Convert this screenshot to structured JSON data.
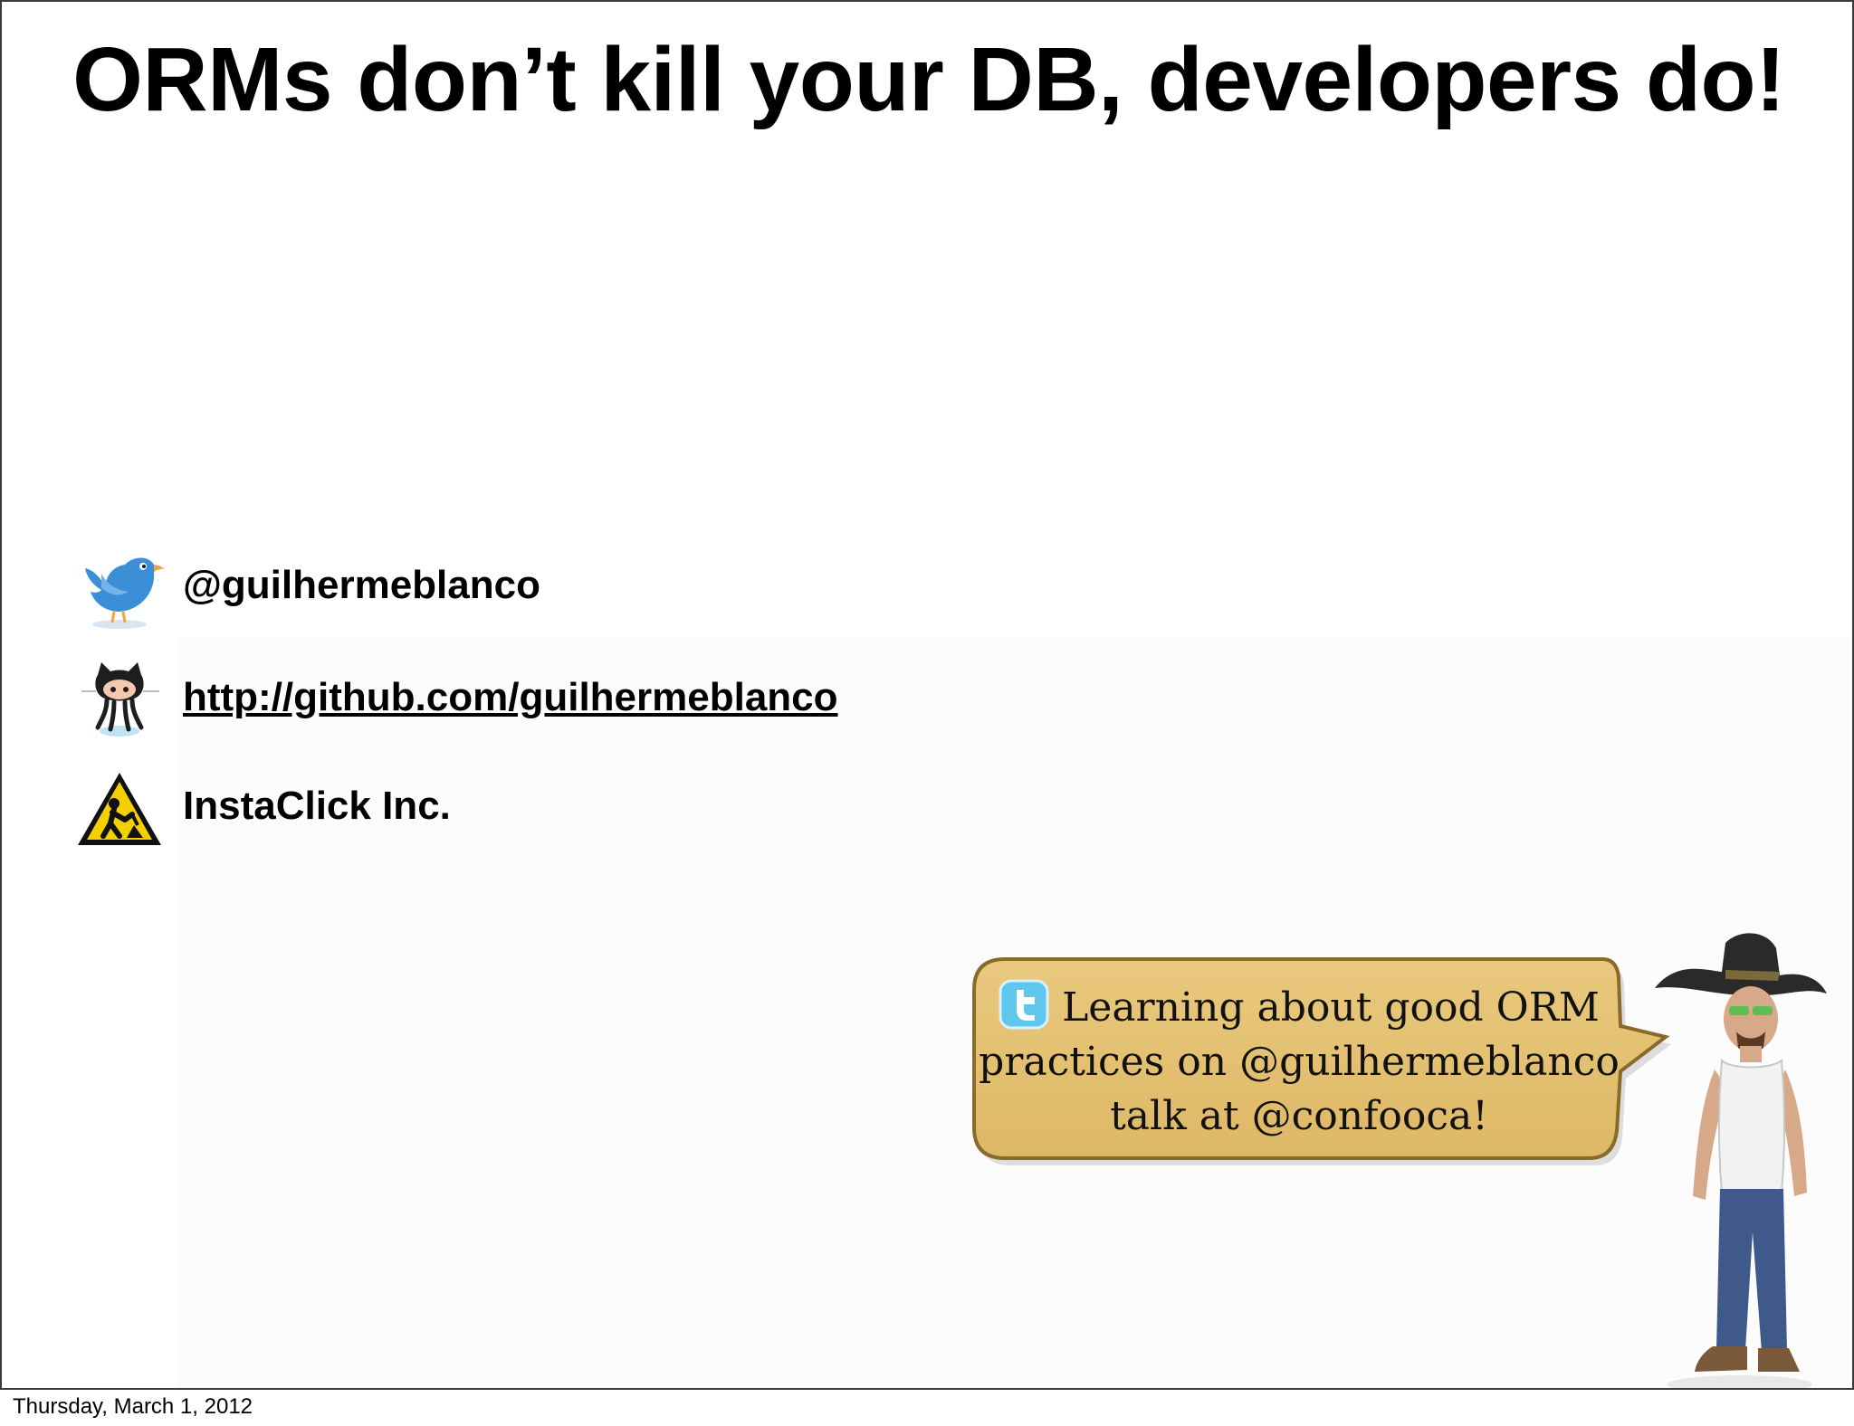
{
  "slide": {
    "title": "ORMs don’t kill your DB, developers do!"
  },
  "contacts": {
    "twitter_handle": "@guilhermeblanco",
    "github_url": "http://github.com/guilhermeblanco",
    "company": "InstaClick Inc."
  },
  "icons": {
    "twitter": "twitter-bird-icon",
    "github": "github-octocat-icon",
    "company": "construction-worker-sign-icon",
    "bubble": "twitter-logo-icon"
  },
  "speech_bubble": {
    "line1": "Learning about good ORM",
    "line2": "practices on @guilhermeblanco",
    "line3": "talk at @confooca!"
  },
  "footer": {
    "date": "Thursday, March 1, 2012"
  },
  "colors": {
    "bubble_fill": "#e3c06f",
    "bubble_border": "#8a6a2a",
    "twitter_blue": "#3b8fd6",
    "warning_yellow": "#f5d000"
  }
}
